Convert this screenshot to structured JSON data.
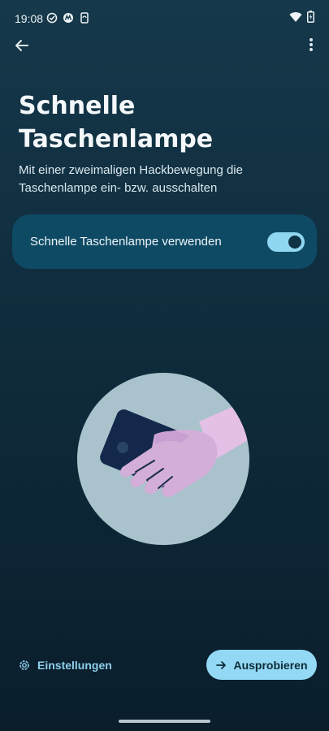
{
  "status_bar": {
    "time": "19:08",
    "icons_left": [
      "check-circle-icon",
      "motorola-icon",
      "phone-sync-icon"
    ],
    "icons_right": [
      "wifi-icon",
      "battery-charging-icon"
    ]
  },
  "top_bar": {
    "back_icon": "arrow-left-icon",
    "more_icon": "more-vertical-icon"
  },
  "page": {
    "title_line1": "Schnelle",
    "title_line2": "Taschenlampe",
    "subtitle": "Mit einer zweimaligen Hackbewegung die Taschenlampe ein- bzw. ausschalten"
  },
  "toggle": {
    "label": "Schnelle Taschenlampe verwenden",
    "state": "on"
  },
  "illustration": {
    "icon": "hand-holding-phone-icon"
  },
  "bottom": {
    "settings_label": "Einstellungen",
    "settings_icon": "gear-icon",
    "try_label": "Ausprobieren",
    "try_icon": "arrow-right-icon"
  },
  "colors": {
    "background_top": "#15384a",
    "background_bottom": "#0a1e2c",
    "card": "#0f4a65",
    "accent": "#93d8f4",
    "illustration_circle": "#a9c2cc",
    "hand": "#d2aed8",
    "phone": "#13284a"
  }
}
